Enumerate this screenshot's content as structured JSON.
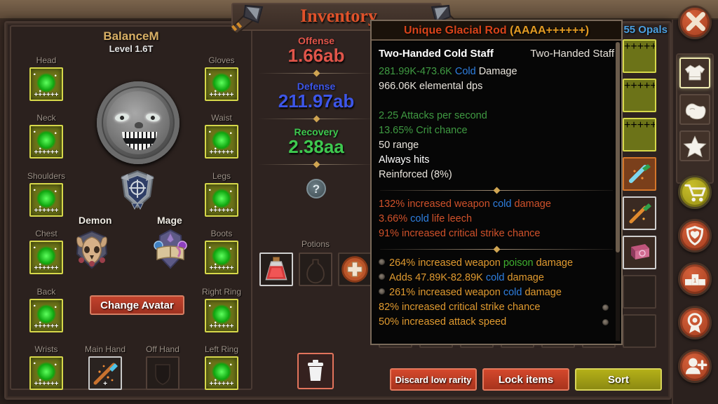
{
  "window": {
    "title": "Inventory"
  },
  "currency": {
    "amount_label": "55 Opals",
    "icon": "coin-icon"
  },
  "character": {
    "name": "BalanceM",
    "level": "Level 1.6T",
    "portrait_icon": "skull-avatar-icon",
    "crest_icon": "guild-crest-icon",
    "change_avatar_label": "Change Avatar",
    "classes": [
      {
        "label": "Demon",
        "icon": "demon-class-icon"
      },
      {
        "label": "Mage",
        "icon": "mage-class-icon"
      }
    ],
    "slots_left": [
      {
        "label": "Head",
        "pluses": "++++++",
        "state": "filled"
      },
      {
        "label": "Neck",
        "pluses": "++++++",
        "state": "filled"
      },
      {
        "label": "Shoulders",
        "pluses": "++++++",
        "state": "filled"
      },
      {
        "label": "Chest",
        "pluses": "++++++",
        "state": "filled"
      },
      {
        "label": "Back",
        "pluses": "++++++",
        "state": "filled"
      },
      {
        "label": "Wrists",
        "pluses": "++++++",
        "state": "filled"
      }
    ],
    "slots_right": [
      {
        "label": "Gloves",
        "pluses": "++++++",
        "state": "filled"
      },
      {
        "label": "Waist",
        "pluses": "++++++",
        "state": "filled"
      },
      {
        "label": "Legs",
        "pluses": "++++++",
        "state": "filled"
      },
      {
        "label": "Boots",
        "pluses": "++++++",
        "state": "filled"
      },
      {
        "label": "Right Ring",
        "pluses": "++++++",
        "state": "filled"
      },
      {
        "label": "Left Ring",
        "pluses": "++++++",
        "state": "filled"
      }
    ],
    "slots_bottom": [
      {
        "label": "Main Hand",
        "pluses": "+",
        "state": "equipped"
      },
      {
        "label": "Off Hand",
        "pluses": "",
        "state": "empty"
      }
    ]
  },
  "stats": {
    "items": [
      {
        "name": "Offense",
        "value": "1.66ab",
        "color": "#e0554a"
      },
      {
        "name": "Defense",
        "value": "211.97ab",
        "color": "#3d56e8"
      },
      {
        "name": "Recovery",
        "value": "2.38aa",
        "color": "#3ec94f"
      }
    ],
    "help_label": "?"
  },
  "potions": {
    "label": "Potions",
    "slots": [
      {
        "state": "filled",
        "icon": "health-potion-icon"
      },
      {
        "state": "empty",
        "icon": "empty-flask-icon"
      },
      {
        "state": "add",
        "icon": "plus-icon"
      }
    ]
  },
  "trash": {
    "icon": "trash-icon"
  },
  "tooltip": {
    "title_main": "Unique Glacial Rod",
    "title_rank": "(AAAA++++++)",
    "title_main_color": "#d8431a",
    "title_rank_color": "#e39b22",
    "subtitle_left": "Two-Handed Cold Staff",
    "subtitle_right": "Two-Handed Staff",
    "base_stats": [
      {
        "parts": [
          {
            "t": "281.99K-473.6K",
            "c": "#3f9a42"
          },
          {
            "t": " Cold",
            "c": "#2e7fe0"
          },
          {
            "t": " Damage",
            "c": "#e9e4dc"
          }
        ]
      },
      {
        "parts": [
          {
            "t": "966.06K elemental dps",
            "c": "#e9e4dc"
          }
        ]
      },
      {
        "parts": [
          {
            "t": "",
            "c": "#e9e4dc"
          }
        ]
      },
      {
        "parts": [
          {
            "t": "2.25 Attacks per second",
            "c": "#3f9a42"
          }
        ]
      },
      {
        "parts": [
          {
            "t": "13.65% Crit chance",
            "c": "#3f9a42"
          }
        ]
      },
      {
        "parts": [
          {
            "t": "50 range",
            "c": "#e9e4dc"
          }
        ]
      },
      {
        "parts": [
          {
            "t": "Always hits",
            "c": "#ffffff"
          }
        ]
      },
      {
        "parts": [
          {
            "t": "Reinforced (8%)",
            "c": "#e9e4dc"
          }
        ]
      }
    ],
    "unique_affixes": [
      {
        "parts": [
          {
            "t": "132% increased weapon ",
            "c": "#d0512a"
          },
          {
            "t": "cold",
            "c": "#2e7fe0"
          },
          {
            "t": " damage",
            "c": "#d0512a"
          }
        ]
      },
      {
        "parts": [
          {
            "t": "3.66% ",
            "c": "#d0512a"
          },
          {
            "t": "cold",
            "c": "#2e7fe0"
          },
          {
            "t": " life leech",
            "c": "#d0512a"
          }
        ]
      },
      {
        "parts": [
          {
            "t": "91% increased critical strike chance",
            "c": "#d0512a"
          }
        ]
      }
    ],
    "rolled_affixes": [
      {
        "bullet_left": true,
        "bullet_right": false,
        "parts": [
          {
            "t": "264% increased weapon ",
            "c": "#e09a2f"
          },
          {
            "t": "poison",
            "c": "#3fb02f"
          },
          {
            "t": " damage",
            "c": "#e09a2f"
          }
        ]
      },
      {
        "bullet_left": true,
        "bullet_right": false,
        "parts": [
          {
            "t": "Adds 47.89K-82.89K ",
            "c": "#e09a2f"
          },
          {
            "t": "cold",
            "c": "#2e7fe0"
          },
          {
            "t": " damage",
            "c": "#e09a2f"
          }
        ]
      },
      {
        "bullet_left": true,
        "bullet_right": false,
        "parts": [
          {
            "t": "261% increased weapon ",
            "c": "#e09a2f"
          },
          {
            "t": "cold",
            "c": "#2e7fe0"
          },
          {
            "t": " damage",
            "c": "#e09a2f"
          }
        ]
      },
      {
        "bullet_left": false,
        "bullet_right": true,
        "parts": [
          {
            "t": "82% increased critical strike chance",
            "c": "#e09a2f"
          }
        ]
      },
      {
        "bullet_left": false,
        "bullet_right": true,
        "parts": [
          {
            "t": "50% increased attack speed",
            "c": "#e09a2f"
          }
        ]
      }
    ]
  },
  "inventory": {
    "items": [
      {
        "row": 0,
        "col": 6,
        "rarity": "yellow",
        "pluses": "++++++",
        "icon": "green-helm-icon"
      },
      {
        "row": 1,
        "col": 6,
        "rarity": "yellow",
        "pluses": "++++++",
        "icon": "green-bracer-icon"
      },
      {
        "row": 2,
        "col": 6,
        "rarity": "yellow",
        "pluses": "++++++",
        "icon": "green-glove-icon"
      },
      {
        "row": 3,
        "col": 6,
        "rarity": "orange",
        "pluses": "++++++",
        "icon": "blue-dagger-icon"
      },
      {
        "row": 4,
        "col": 6,
        "rarity": "white",
        "pluses": "",
        "icon": "orange-wand-icon"
      },
      {
        "row": 5,
        "col": 6,
        "rarity": "white",
        "pluses": "",
        "icon": "pink-tome-icon"
      }
    ],
    "rows": 8,
    "cols": 7
  },
  "footer": {
    "buttons": [
      {
        "label": "Discard low rarity",
        "style": "red"
      },
      {
        "label": "Lock items",
        "style": "red"
      },
      {
        "label": "Sort",
        "style": "olive"
      }
    ]
  },
  "rail": {
    "close": {
      "icon": "close-x-icon"
    },
    "tabs": [
      {
        "icon": "shirt-icon",
        "name": "equipment-tab",
        "selected": true
      },
      {
        "icon": "muscle-icon",
        "name": "stats-tab",
        "selected": false
      },
      {
        "icon": "star-icon",
        "name": "skills-tab",
        "selected": false
      }
    ],
    "buttons": [
      {
        "icon": "cart-icon",
        "name": "shop-button",
        "style": "yl"
      },
      {
        "icon": "shield-icon",
        "name": "clan-button",
        "style": "or"
      },
      {
        "icon": "podium-icon",
        "name": "leaderboard-button",
        "style": "or"
      },
      {
        "icon": "ribbon-icon",
        "name": "achievements-button",
        "style": "or"
      },
      {
        "icon": "add-user-icon",
        "name": "friends-button",
        "style": "or"
      }
    ]
  }
}
